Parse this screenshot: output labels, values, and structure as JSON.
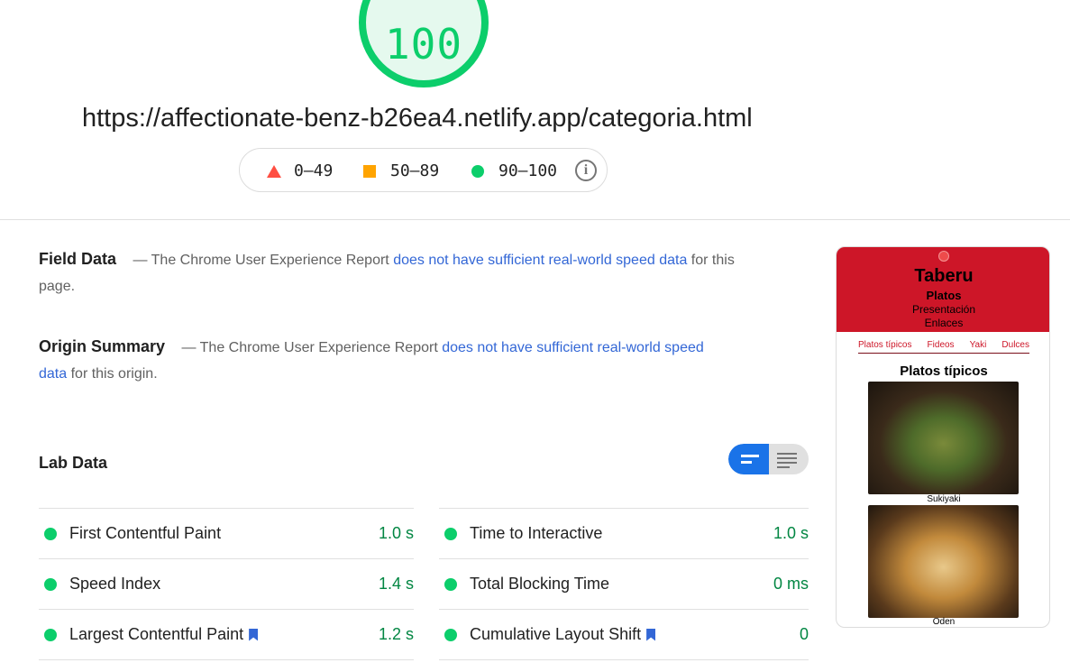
{
  "score": "100",
  "url": "https://affectionate-benz-b26ea4.netlify.app/categoria.html",
  "legend": {
    "fail": "0–49",
    "average": "50–89",
    "pass": "90–100"
  },
  "field_data": {
    "title": "Field Data",
    "text_before": "— The Chrome User Experience Report",
    "link": "does not have sufficient real-world speed data",
    "text_after": "for this page."
  },
  "origin_summary": {
    "title": "Origin Summary",
    "text_before": "— The Chrome User Experience Report",
    "link": "does not have sufficient real-world speed data",
    "text_after": "for this origin."
  },
  "lab_data": {
    "title": "Lab Data",
    "metrics_left": [
      {
        "label": "First Contentful Paint",
        "value": "1.0 s"
      },
      {
        "label": "Speed Index",
        "value": "1.4 s"
      },
      {
        "label": "Largest Contentful Paint",
        "value": "1.2 s"
      }
    ],
    "metrics_right": [
      {
        "label": "Time to Interactive",
        "value": "1.0 s"
      },
      {
        "label": "Total Blocking Time",
        "value": "0 ms"
      },
      {
        "label": "Cumulative Layout Shift",
        "value": "0"
      }
    ]
  },
  "thumbnail": {
    "title": "Taberu",
    "subtitle": "Platos",
    "link1": "Presentación",
    "link2": "Enlaces",
    "nav": [
      "Platos típicos",
      "Fideos",
      "Yaki",
      "Dulces"
    ],
    "section": "Platos típicos",
    "caption1": "Sukiyaki",
    "caption2": "Oden"
  },
  "colors": {
    "pass": "#0cce6b",
    "average": "#ffa400",
    "fail": "#ff4e42",
    "link": "#3367d6",
    "brand_red": "#cd1628"
  }
}
